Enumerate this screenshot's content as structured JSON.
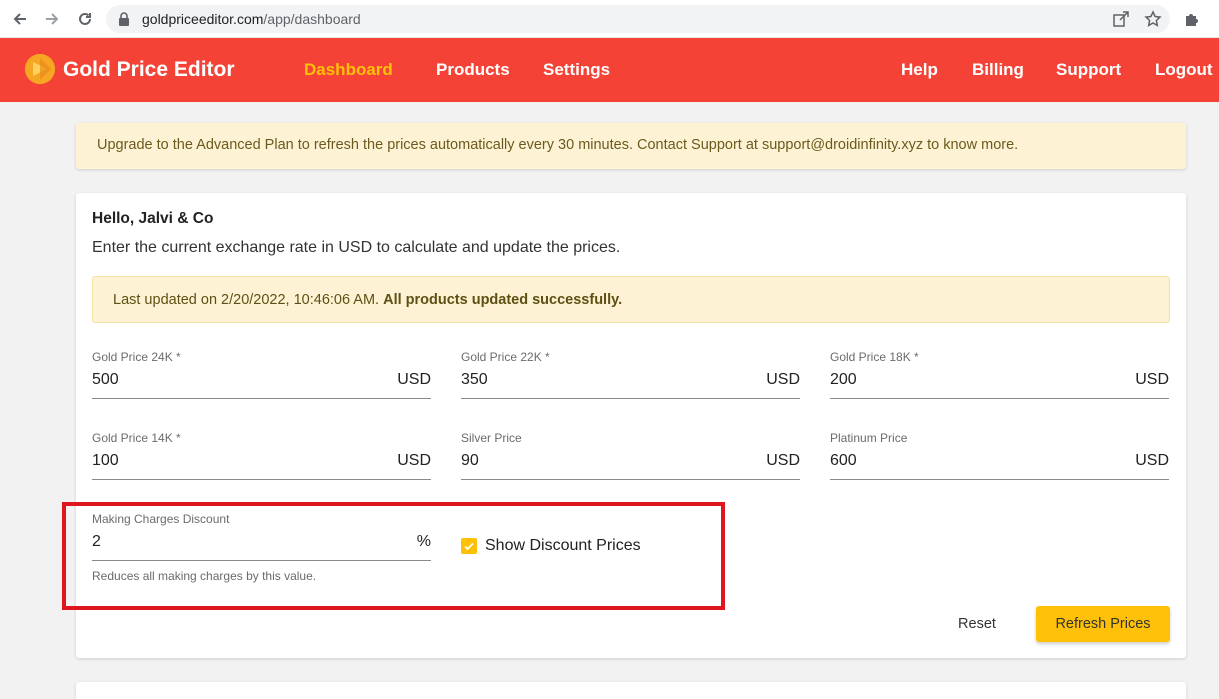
{
  "browser": {
    "url_domain": "goldpriceeditor.com",
    "url_path": "/app/dashboard",
    "icons": [
      "back-arrow-icon",
      "forward-arrow-icon",
      "reload-icon",
      "lock-icon",
      "share-icon",
      "star-icon",
      "puzzle-icon"
    ]
  },
  "header": {
    "brand": "Gold Price Editor",
    "nav_left": [
      "Dashboard",
      "Products",
      "Settings"
    ],
    "nav_right": [
      "Help",
      "Billing",
      "Support",
      "Logout"
    ],
    "active": "Dashboard",
    "colors": {
      "header_bg": "#f44336",
      "active_link": "#ffc107"
    }
  },
  "banner": {
    "text": "Upgrade to the Advanced Plan to refresh the prices automatically every 30 minutes. Contact Support at support@droidinfinity.xyz to know more."
  },
  "card": {
    "greeting": "Hello, Jalvi & Co",
    "instruction": "Enter the current exchange rate in USD to calculate and update the prices.",
    "status_prefix": "Last updated on 2/20/2022, 10:46:06 AM.",
    "status_bold": "All products updated successfully.",
    "fields": [
      {
        "label": "Gold Price 24K *",
        "value": "500",
        "unit": "USD"
      },
      {
        "label": "Gold Price 22K *",
        "value": "350",
        "unit": "USD"
      },
      {
        "label": "Gold Price 18K *",
        "value": "200",
        "unit": "USD"
      },
      {
        "label": "Gold Price 14K *",
        "value": "100",
        "unit": "USD"
      },
      {
        "label": "Silver Price",
        "value": "90",
        "unit": "USD"
      },
      {
        "label": "Platinum Price",
        "value": "600",
        "unit": "USD"
      }
    ],
    "discount": {
      "label": "Making Charges Discount",
      "value": "2",
      "unit": "%",
      "help": "Reduces all making charges by this value."
    },
    "show_discount": {
      "label": "Show Discount Prices",
      "checked": true
    },
    "reset_label": "Reset",
    "refresh_label": "Refresh Prices",
    "accent": "#ffc107"
  }
}
